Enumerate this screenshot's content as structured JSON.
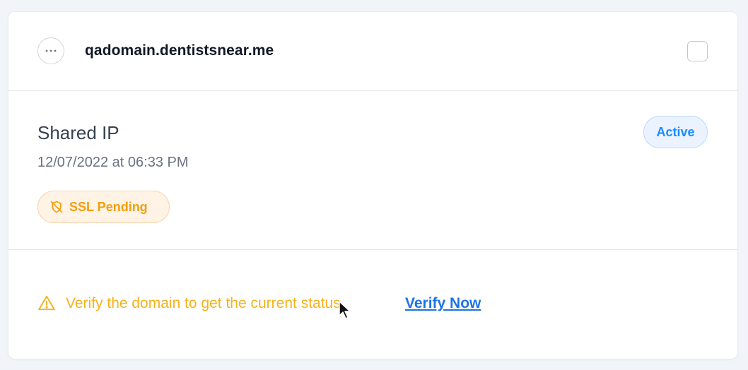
{
  "header": {
    "domain": "qadomain.dentistsnear.me",
    "more_icon": "more-horizontal-icon",
    "checkbox_checked": false
  },
  "details": {
    "ip_type": "Shared IP",
    "date": "12/07/2022 at 06:33 PM",
    "status": "Active",
    "ssl_badge": "SSL Pending",
    "ssl_icon": "shield-off-icon"
  },
  "verification": {
    "message": "Verify the domain to get the current status",
    "link_label": "Verify Now",
    "warning_icon": "warning-triangle-icon"
  },
  "colors": {
    "status_blue": "#1a8cff",
    "ssl_orange": "#f59e0b",
    "warning_yellow": "#f6b21b",
    "link_blue": "#1d72e8"
  }
}
